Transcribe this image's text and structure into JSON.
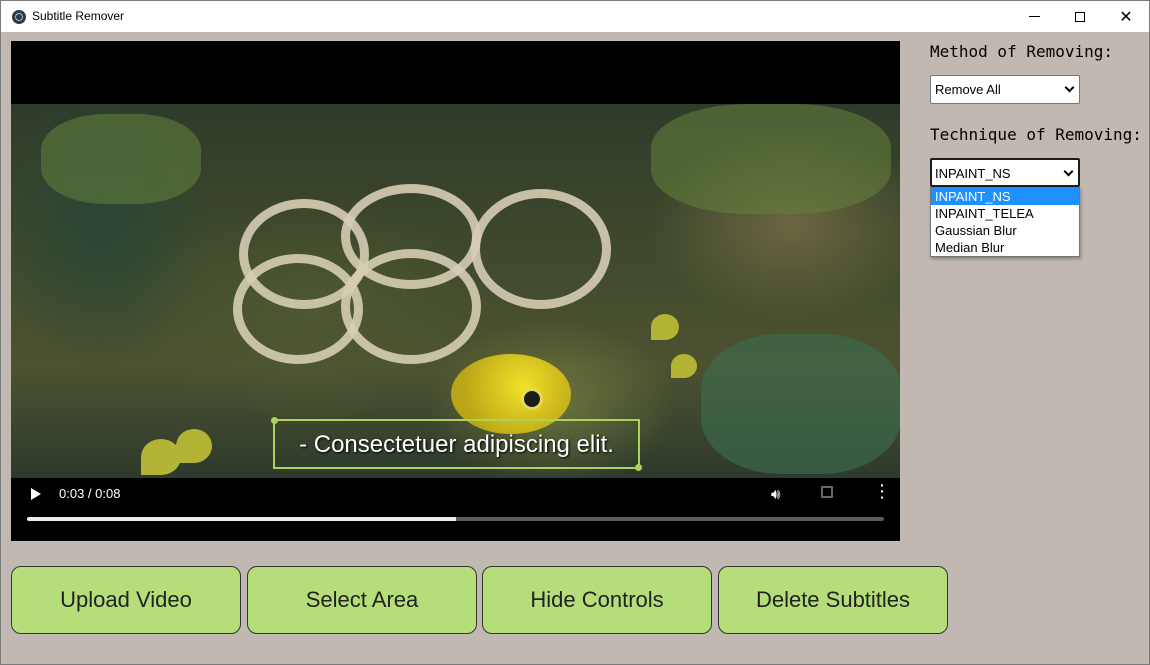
{
  "window": {
    "title": "Subtitle Remover",
    "icon": "app-icon"
  },
  "video": {
    "subtitle_text": "- Consectetuer adipiscing elit.",
    "time_display": "0:03 / 0:08",
    "progress_fraction": 0.5,
    "icons": [
      "play-icon",
      "volume-icon",
      "fullscreen-icon",
      "more-options-icon"
    ]
  },
  "side_panel": {
    "method_label": "Method of Removing:",
    "method_value": "Remove All",
    "technique_label": "Technique of Removing:",
    "technique_value": "INPAINT_NS",
    "technique_options": [
      "INPAINT_NS",
      "INPAINT_TELEA",
      "Gaussian Blur",
      "Median Blur"
    ],
    "technique_selected_index": 0
  },
  "buttons": {
    "upload": "Upload Video",
    "select_area": "Select Area",
    "hide_controls": "Hide Controls",
    "delete_subtitles": "Delete Subtitles"
  },
  "colors": {
    "background": "#c1b8b1",
    "button_fill": "#b5de7a",
    "selection_box": "#a9d35a",
    "dropdown_highlight": "#1e90ff"
  }
}
